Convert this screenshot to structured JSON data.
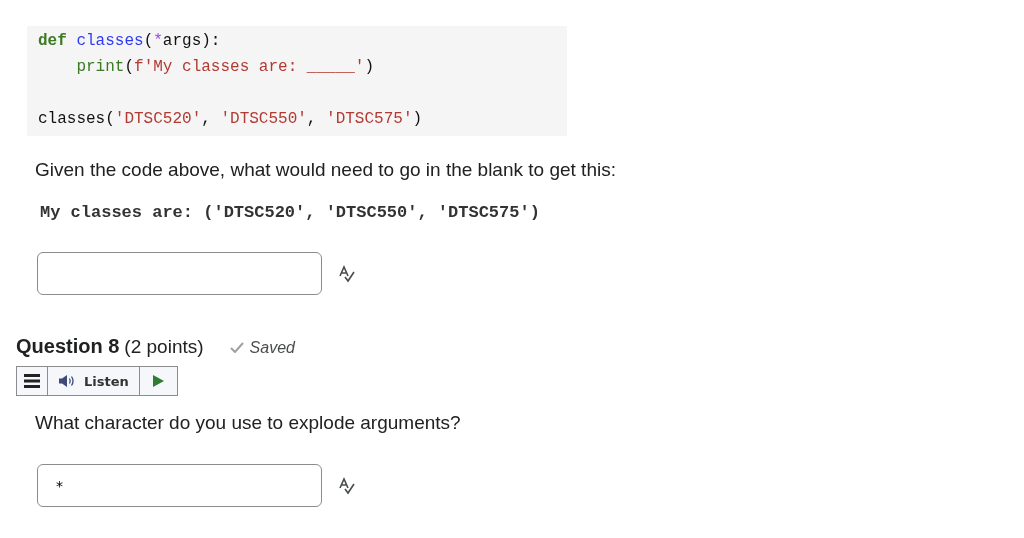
{
  "code": {
    "blocks": [
      {
        "lines": [
          {
            "tokens": [
              {
                "kind": "keyword",
                "text": "def"
              },
              {
                "kind": "function",
                "text": " classes"
              },
              {
                "kind": "plain",
                "text": "("
              },
              {
                "kind": "operator",
                "text": "*"
              },
              {
                "kind": "plain",
                "text": "args):"
              }
            ]
          },
          {
            "tokens": [
              {
                "kind": "keyword",
                "text": "    print"
              },
              {
                "kind": "plain",
                "text": "("
              },
              {
                "kind": "string",
                "text": "f'My classes are: _____'"
              },
              {
                "kind": "plain",
                "text": ")"
              }
            ]
          }
        ]
      },
      {
        "lines": [
          {
            "tokens": [
              {
                "kind": "plain",
                "text": "classes("
              },
              {
                "kind": "string",
                "text": "'DTSC520'"
              },
              {
                "kind": "plain",
                "text": ", "
              },
              {
                "kind": "string",
                "text": "'DTSC550'"
              },
              {
                "kind": "plain",
                "text": ", "
              },
              {
                "kind": "string",
                "text": "'DTSC575'"
              },
              {
                "kind": "plain",
                "text": ")"
              }
            ]
          }
        ]
      }
    ]
  },
  "question_7": {
    "prompt": "Given the code above, what would need to go in the blank to get this:",
    "output": "My classes are: ('DTSC520', 'DTSC550', 'DTSC575')"
  },
  "question_8": {
    "title": "Question 8",
    "points": "(2 points)",
    "status": "Saved",
    "listen": "Listen",
    "prompt": "What character do you use to explode arguments?",
    "answer": {
      "value": "*"
    }
  }
}
